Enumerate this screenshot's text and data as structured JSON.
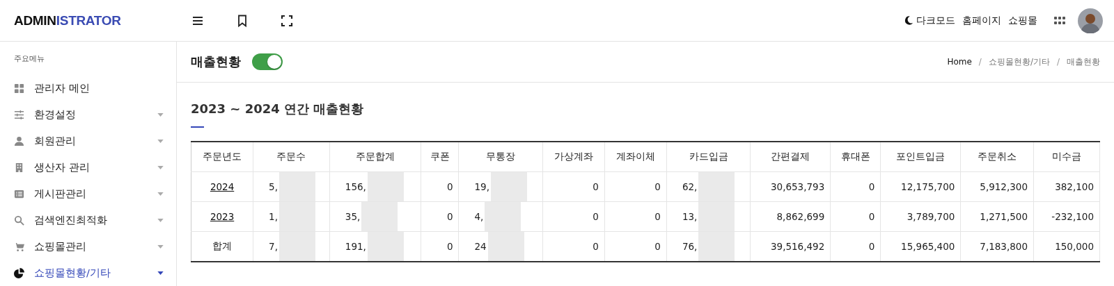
{
  "logo": {
    "dark": "ADMIN",
    "accent": "ISTRATOR"
  },
  "header_links": [
    {
      "kind": "darkmode",
      "label": "다크모드"
    },
    {
      "kind": "link",
      "label": "홈페이지"
    },
    {
      "kind": "link",
      "label": "쇼핑몰"
    }
  ],
  "sidebar": {
    "heading": "주요메뉴",
    "items": [
      {
        "kind": "grid",
        "label": "관리자 메인",
        "has_submenu": false,
        "selected": false
      },
      {
        "kind": "sliders",
        "label": "환경설정",
        "has_submenu": true,
        "selected": false
      },
      {
        "kind": "person",
        "label": "회원관리",
        "has_submenu": true,
        "selected": false
      },
      {
        "kind": "building",
        "label": "생산자 관리",
        "has_submenu": true,
        "selected": false
      },
      {
        "kind": "list",
        "label": "게시판관리",
        "has_submenu": true,
        "selected": false
      },
      {
        "kind": "search",
        "label": "검색엔진최적화",
        "has_submenu": true,
        "selected": false
      },
      {
        "kind": "cart",
        "label": "쇼핑몰관리",
        "has_submenu": true,
        "selected": false
      },
      {
        "kind": "pie",
        "label": "쇼핑몰현황/기타",
        "has_submenu": true,
        "selected": true
      }
    ]
  },
  "page": {
    "title": "매출현황",
    "toggle_on": true,
    "breadcrumb": [
      {
        "kind": "link",
        "label": "Home"
      },
      {
        "kind": "separator",
        "label": "/"
      },
      {
        "kind": "link",
        "label": "쇼핑몰현황/기타"
      },
      {
        "kind": "separator",
        "label": "/"
      },
      {
        "kind": "current",
        "label": "매출현황"
      }
    ]
  },
  "section_title": "2023 ~ 2024 연간 매출현황",
  "table": {
    "columns": [
      {
        "label": "주문년도",
        "redacted": false
      },
      {
        "label": "주문수",
        "redacted": true
      },
      {
        "label": "주문합계",
        "redacted": true
      },
      {
        "label": "쿠폰",
        "redacted": false
      },
      {
        "label": "무통장",
        "redacted": true
      },
      {
        "label": "가상계좌",
        "redacted": false
      },
      {
        "label": "계좌이체",
        "redacted": false
      },
      {
        "label": "카드입금",
        "redacted": true
      },
      {
        "label": "간편결제",
        "redacted": false
      },
      {
        "label": "휴대폰",
        "redacted": false
      },
      {
        "label": "포인트입금",
        "redacted": false
      },
      {
        "label": "주문취소",
        "redacted": false
      },
      {
        "label": "미수금",
        "redacted": false
      }
    ],
    "rows": [
      {
        "kind": "link",
        "cells": [
          "2024",
          "5,",
          "156,",
          "0",
          "19,",
          "0",
          "0",
          "62,",
          "30,653,793",
          "0",
          "12,175,700",
          "5,912,300",
          "382,100"
        ]
      },
      {
        "kind": "link",
        "cells": [
          "2023",
          "1,",
          "35,",
          "0",
          "4,",
          "0",
          "0",
          "13,",
          "8,862,699",
          "0",
          "3,789,700",
          "1,271,500",
          "-232,100"
        ]
      },
      {
        "kind": "total",
        "cells": [
          "합계",
          "7,",
          "191,",
          "0",
          "24",
          "0",
          "0",
          "76,",
          "39,516,492",
          "0",
          "15,965,400",
          "7,183,800",
          "150,000"
        ]
      }
    ]
  }
}
